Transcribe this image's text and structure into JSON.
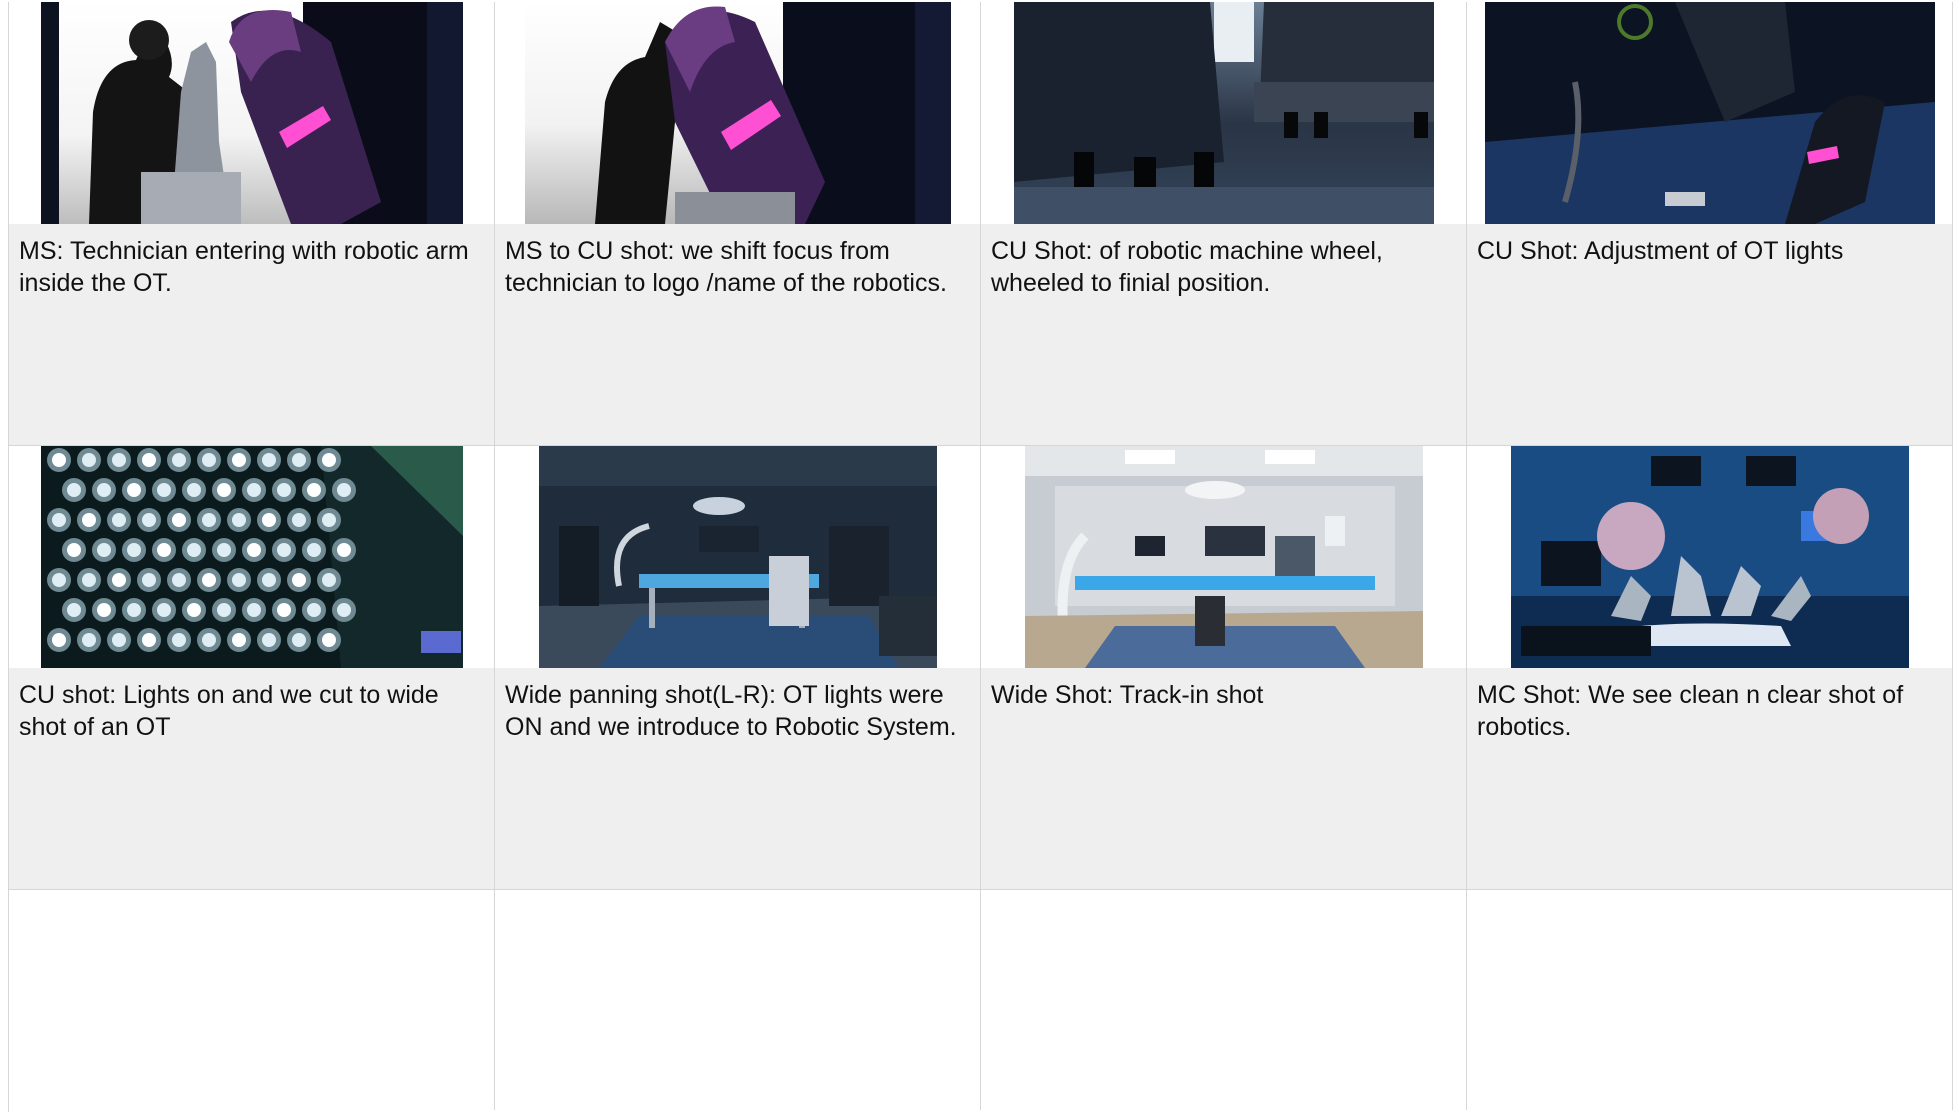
{
  "storyboard": {
    "rows": [
      {
        "shots": [
          {
            "caption": "MS: Technician entering with robotic arm inside the OT.",
            "thumb": "technician-robotic-arm-image"
          },
          {
            "caption": "MS to CU shot: we shift focus from technician to logo /name of the robotics.",
            "thumb": "robotic-arm-logo-image"
          },
          {
            "caption": "CU Shot: of robotic machine wheel, wheeled to finial position.",
            "thumb": "machine-wheel-image"
          },
          {
            "caption": "CU Shot: Adjustment of OT lights",
            "thumb": "ot-lights-adjustment-image"
          }
        ]
      },
      {
        "shots": [
          {
            "caption": "CU shot: Lights on and we cut to wide shot of an OT",
            "thumb": "led-lights-image"
          },
          {
            "caption": "Wide panning shot(L-R): OT lights were ON and we introduce to Robotic System.",
            "thumb": "operating-theatre-dark-image"
          },
          {
            "caption": "Wide Shot: Track-in shot",
            "thumb": "operating-theatre-bright-image"
          },
          {
            "caption": "MC Shot: We see clean n clear shot of robotics.",
            "thumb": "surgical-robot-image"
          }
        ]
      }
    ],
    "colors": {
      "caption_bg": "#efefef",
      "grid_line": "#d6d6d6",
      "text": "#111111"
    }
  }
}
